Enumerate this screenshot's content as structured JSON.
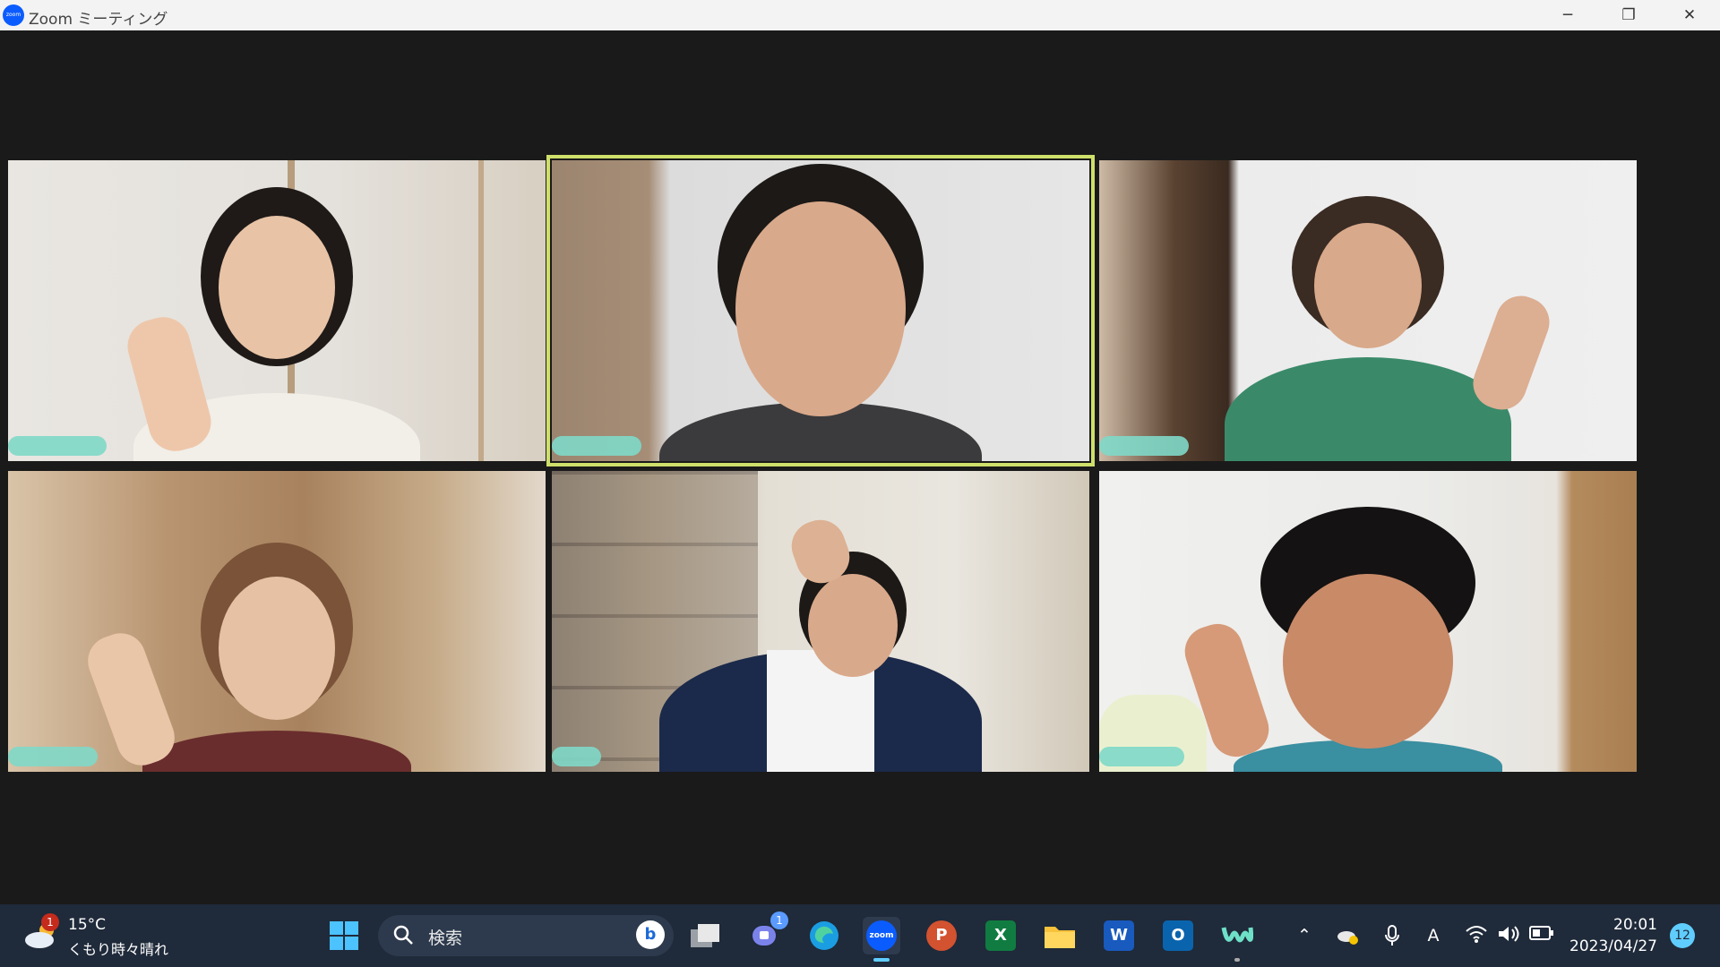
{
  "window": {
    "title": "Zoom ミーティング",
    "logo_text": "zoom"
  },
  "controls": {
    "minimize": "─",
    "restore": "❐",
    "close": "✕"
  },
  "gallery": {
    "active_speaker_index": 1,
    "tiles": [
      {
        "name": ""
      },
      {
        "name": ""
      },
      {
        "name": ""
      },
      {
        "name": ""
      },
      {
        "name": ""
      },
      {
        "name": ""
      }
    ]
  },
  "taskbar": {
    "weather": {
      "temp": "15°C",
      "desc": "くもり時々晴れ",
      "badge": "1"
    },
    "search": {
      "placeholder": "検索"
    },
    "pinned": [
      {
        "name": "start",
        "icon": "windows-icon"
      },
      {
        "name": "task-view",
        "icon": "task-view-icon"
      },
      {
        "name": "teams",
        "icon": "teams-icon",
        "badge": "1"
      },
      {
        "name": "edge",
        "icon": "edge-icon"
      },
      {
        "name": "zoom",
        "icon": "zoom-icon",
        "label": "zoom"
      },
      {
        "name": "powerpoint",
        "icon": "powerpoint-icon",
        "label": "P"
      },
      {
        "name": "excel",
        "icon": "excel-icon",
        "label": "X"
      },
      {
        "name": "file-explorer",
        "icon": "folder-icon"
      },
      {
        "name": "word",
        "icon": "word-icon",
        "label": "W"
      },
      {
        "name": "outlook",
        "icon": "outlook-icon",
        "label": "O"
      },
      {
        "name": "webex",
        "icon": "webex-icon"
      }
    ],
    "tray": {
      "ime": "A"
    },
    "clock": {
      "time": "20:01",
      "date": "2023/04/27"
    },
    "notifications": "12"
  },
  "colors": {
    "active_speaker": "#cfe06a",
    "taskbar": "#1f2a3a",
    "accent": "#60cdff"
  }
}
